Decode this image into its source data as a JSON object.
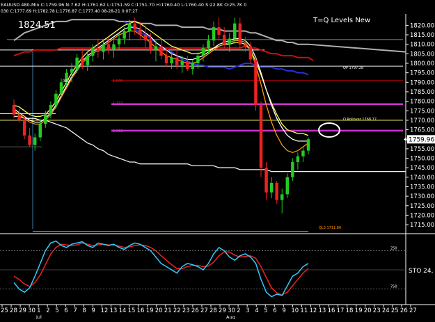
{
  "header": {
    "symbol_line": "EAUUSD 480-Min  C:1759.96 N:7.62 H:1761.62 L:1751.59 C:1751.70 H:1760.40 L:1760.40 S:22.8K O:25.7K  0",
    "sub_line": "030  C:1777.69  H:1782.78  L:1776.87  C:1777.40  08-28-21  0:07:27"
  },
  "big_price_label": "1824.51",
  "chart_title": "T=Q Levels New",
  "colors": {
    "background": "#000000",
    "up_candle": "#22cc22",
    "down_candle": "#ee2222",
    "magenta_level": "#cc33cc",
    "orange_level": "#ff9900",
    "yellow_level": "#ffff66",
    "dark_red_level": "#aa0000",
    "white_ma": "#f0f0f0",
    "gray_ma": "#b0b0b0",
    "red_ma": "#cc1111",
    "blue_ma": "#2233dd",
    "cyan_sto": "#33ccff",
    "red_sto": "#ee2222"
  },
  "chart_data": {
    "type": "candlestick",
    "title": "T=Q Levels New",
    "timeframe": "480-Min",
    "ylim": [
      1711,
      1826
    ],
    "yticks": [
      1715,
      1720,
      1725,
      1730,
      1735,
      1740,
      1745,
      1750,
      1755,
      1760,
      1765,
      1770,
      1775,
      1780,
      1785,
      1790,
      1795,
      1800,
      1805,
      1810,
      1815,
      1820
    ],
    "x_day_labels": [
      "25",
      "28",
      "29",
      "30",
      "1",
      "2",
      "5",
      "6",
      "7",
      "8",
      "9",
      "12",
      "13",
      "14",
      "15",
      "16",
      "19",
      "20",
      "21",
      "22",
      "23",
      "26",
      "27",
      "28",
      "29",
      "30",
      "2",
      "3",
      "4",
      "5",
      "6",
      "9",
      "10",
      "11",
      "12",
      "13",
      "16",
      "17",
      "18",
      "19",
      "20",
      "23",
      "24",
      "25",
      "26",
      "27"
    ],
    "x_month_labels": [
      "Jul",
      "Aug"
    ],
    "last_price": "1759.96",
    "levels": [
      {
        "name": "1.000",
        "value": 1791.0,
        "color": "#aa0000"
      },
      {
        "name": "1.272",
        "value": 1778.5,
        "color": "#cc33cc"
      },
      {
        "name": "1.618",
        "value": 1764.5,
        "color": "#cc33cc"
      },
      {
        "name": "yellow-level",
        "value": 1770.0,
        "color": "#ffff66"
      },
      {
        "name": "white-level",
        "value": 1798.5,
        "color": "#f0f0f0"
      },
      {
        "name": "orange-bottom",
        "value": 1711.5,
        "color": "#ff9900"
      }
    ],
    "level_labels": {
      "l1000": "1.000",
      "l1272": "1.272",
      "l1618": "1.618",
      "qp": "QP 1797.28",
      "rollover": "Q Rollover 1768.77",
      "ql3": "QL3 1711.80",
      "n1": "080"
    },
    "candles": [
      [
        1778,
        1781,
        1771,
        1773
      ],
      [
        1773,
        1776,
        1769,
        1770
      ],
      [
        1770,
        1772,
        1760,
        1762
      ],
      [
        1762,
        1766,
        1756,
        1757
      ],
      [
        1757,
        1763,
        1754,
        1761
      ],
      [
        1761,
        1770,
        1759,
        1768
      ],
      [
        1768,
        1775,
        1766,
        1773
      ],
      [
        1773,
        1780,
        1771,
        1778
      ],
      [
        1778,
        1786,
        1776,
        1784
      ],
      [
        1784,
        1792,
        1782,
        1790
      ],
      [
        1790,
        1797,
        1788,
        1795
      ],
      [
        1795,
        1800,
        1790,
        1797
      ],
      [
        1797,
        1805,
        1795,
        1803
      ],
      [
        1803,
        1808,
        1797,
        1799
      ],
      [
        1799,
        1806,
        1796,
        1804
      ],
      [
        1804,
        1810,
        1801,
        1808
      ],
      [
        1808,
        1813,
        1803,
        1806
      ],
      [
        1806,
        1812,
        1802,
        1810
      ],
      [
        1810,
        1814,
        1805,
        1807
      ],
      [
        1807,
        1812,
        1803,
        1810
      ],
      [
        1810,
        1816,
        1807,
        1813
      ],
      [
        1813,
        1819,
        1810,
        1817
      ],
      [
        1817,
        1823,
        1812,
        1821
      ],
      [
        1821,
        1824,
        1815,
        1818
      ],
      [
        1818,
        1822,
        1812,
        1815
      ],
      [
        1815,
        1820,
        1808,
        1812
      ],
      [
        1812,
        1816,
        1805,
        1807
      ],
      [
        1807,
        1812,
        1801,
        1809
      ],
      [
        1809,
        1813,
        1802,
        1804
      ],
      [
        1804,
        1808,
        1798,
        1800
      ],
      [
        1800,
        1806,
        1797,
        1803
      ],
      [
        1803,
        1807,
        1797,
        1799
      ],
      [
        1799,
        1804,
        1795,
        1801
      ],
      [
        1801,
        1804,
        1796,
        1797
      ],
      [
        1797,
        1802,
        1794,
        1800
      ],
      [
        1800,
        1806,
        1797,
        1804
      ],
      [
        1804,
        1810,
        1801,
        1808
      ],
      [
        1808,
        1815,
        1805,
        1812
      ],
      [
        1812,
        1822,
        1809,
        1819
      ],
      [
        1819,
        1824,
        1812,
        1815
      ],
      [
        1815,
        1819,
        1808,
        1810
      ],
      [
        1810,
        1816,
        1806,
        1813
      ],
      [
        1813,
        1824,
        1810,
        1821
      ],
      [
        1821,
        1824,
        1808,
        1810
      ],
      [
        1810,
        1814,
        1806,
        1809
      ],
      [
        1809,
        1811,
        1800,
        1802
      ],
      [
        1802,
        1803,
        1775,
        1778
      ],
      [
        1778,
        1780,
        1740,
        1745
      ],
      [
        1745,
        1748,
        1728,
        1732
      ],
      [
        1732,
        1740,
        1729,
        1737
      ],
      [
        1737,
        1738,
        1726,
        1728
      ],
      [
        1728,
        1734,
        1721,
        1731
      ],
      [
        1731,
        1742,
        1729,
        1740
      ],
      [
        1740,
        1750,
        1738,
        1748
      ],
      [
        1748,
        1753,
        1744,
        1751
      ],
      [
        1751,
        1756,
        1748,
        1754
      ],
      [
        1754,
        1761,
        1752,
        1760
      ]
    ],
    "stochastic": {
      "label": "STO 24,",
      "levels": [
        80,
        20
      ],
      "level_labels": [
        "250",
        "750"
      ],
      "k": [
        30,
        20,
        15,
        22,
        40,
        60,
        80,
        92,
        95,
        88,
        85,
        90,
        92,
        94,
        88,
        85,
        92,
        90,
        88,
        90,
        85,
        82,
        88,
        92,
        90,
        85,
        80,
        70,
        60,
        55,
        50,
        45,
        55,
        60,
        58,
        55,
        50,
        60,
        75,
        85,
        80,
        70,
        65,
        72,
        75,
        70,
        60,
        35,
        15,
        8,
        12,
        10,
        25,
        40,
        45,
        55,
        60
      ],
      "d": [
        40,
        35,
        28,
        24,
        30,
        42,
        58,
        75,
        85,
        90,
        89,
        88,
        89,
        92,
        90,
        88,
        89,
        90,
        89,
        89,
        87,
        85,
        86,
        88,
        89,
        88,
        85,
        80,
        72,
        65,
        58,
        52,
        52,
        55,
        57,
        57,
        55,
        56,
        62,
        72,
        78,
        78,
        73,
        70,
        71,
        72,
        68,
        55,
        38,
        22,
        14,
        11,
        15,
        25,
        35,
        45,
        52
      ]
    },
    "overlay_lines": [
      {
        "name": "white-ma-long",
        "color": "#f0f0f0",
        "values": [
          1772,
          1772,
          1771,
          1771,
          1771,
          1770,
          1770,
          1769,
          1768,
          1767,
          1766,
          1764,
          1762,
          1760,
          1758,
          1757,
          1755,
          1754,
          1752,
          1751,
          1750,
          1749,
          1748,
          1748,
          1747,
          1747,
          1747,
          1747,
          1747,
          1747,
          1747,
          1747,
          1747,
          1747,
          1746,
          1746,
          1746,
          1746,
          1746,
          1745,
          1745,
          1745,
          1745,
          1744,
          1744,
          1744,
          1744,
          1744,
          1744,
          1743,
          1743,
          1743,
          1743,
          1743,
          1743,
          1743,
          1743
        ]
      },
      {
        "name": "gray-ma",
        "color": "#b0b0b0",
        "values": [
          1812,
          1814,
          1816,
          1817,
          1818,
          1819,
          1820,
          1821,
          1822,
          1822,
          1822,
          1823,
          1823,
          1823,
          1823,
          1823,
          1823,
          1823,
          1823,
          1823,
          1822,
          1822,
          1822,
          1822,
          1821,
          1821,
          1821,
          1820,
          1820,
          1820,
          1820,
          1820,
          1819,
          1819,
          1819,
          1819,
          1819,
          1818,
          1818,
          1818,
          1817,
          1817,
          1817,
          1817,
          1817,
          1816,
          1816,
          1815,
          1814,
          1813,
          1812,
          1812,
          1811,
          1811,
          1810,
          1810,
          1810
        ]
      },
      {
        "name": "red-ma",
        "color": "#cc1111",
        "values": [
          1804,
          1805,
          1806,
          1806,
          1807,
          1807,
          1807,
          1807,
          1807,
          1808,
          1808,
          1808,
          1808,
          1808,
          1808,
          1808,
          1808,
          1808,
          1808,
          1808,
          1808,
          1808,
          1808,
          1808,
          1808,
          1808,
          1808,
          1808,
          1808,
          1808,
          1808,
          1808,
          1808,
          1808,
          1808,
          1808,
          1808,
          1808,
          1808,
          1808,
          1808,
          1808,
          1808,
          1808,
          1809,
          1808,
          1808,
          1807,
          1806,
          1805,
          1805,
          1804,
          1804,
          1804,
          1803,
          1803,
          1803
        ]
      },
      {
        "name": "blue-ma",
        "color": "#2233dd",
        "values": [
          null,
          null,
          null,
          null,
          null,
          null,
          null,
          null,
          null,
          null,
          null,
          null,
          null,
          null,
          null,
          null,
          null,
          null,
          null,
          null,
          null,
          1822,
          1820,
          1818,
          1816,
          1815,
          1813,
          1811,
          1809,
          1807,
          1806,
          1804,
          1802,
          1801,
          1800,
          1799,
          1799,
          1798,
          1798,
          1798,
          1798,
          1797,
          1798,
          1799,
          1800,
          1800,
          1799,
          1798,
          1798,
          1798,
          1797,
          1797,
          1796,
          1796,
          1795,
          1795,
          1794
        ]
      },
      {
        "name": "yellow-ma",
        "color": "#ffff66",
        "values": [
          1778,
          1777,
          1775,
          1773,
          1772,
          1772,
          1773,
          1776,
          1780,
          1785,
          1790,
          1795,
          1799,
          1803,
          1806,
          1808,
          1810,
          1812,
          1814,
          1816,
          1818,
          1820,
          1821,
          1822,
          1821,
          1819,
          1817,
          1815,
          1813,
          1811,
          1809,
          1808,
          1807,
          1806,
          1805,
          1805,
          1806,
          1807,
          1808,
          1809,
          1810,
          1810,
          1811,
          1811,
          1810,
          1807,
          1801,
          1794,
          1786,
          1779,
          1773,
          1768,
          1765,
          1764,
          1763,
          1763,
          1762
        ]
      },
      {
        "name": "orange-ma",
        "color": "#ff9900",
        "values": [
          1775,
          1773,
          1771,
          1769,
          1768,
          1768,
          1770,
          1773,
          1777,
          1782,
          1787,
          1792,
          1796,
          1800,
          1803,
          1805,
          1807,
          1809,
          1811,
          1813,
          1815,
          1816,
          1817,
          1817,
          1815,
          1813,
          1811,
          1808,
          1806,
          1804,
          1803,
          1802,
          1801,
          1800,
          1800,
          1801,
          1803,
          1805,
          1807,
          1809,
          1810,
          1811,
          1812,
          1812,
          1811,
          1807,
          1799,
          1789,
          1778,
          1769,
          1762,
          1757,
          1754,
          1753,
          1754,
          1756,
          1758
        ]
      },
      {
        "name": "white-ma-short",
        "color": "#ffffff",
        "values": [
          1776,
          1774,
          1772,
          1770,
          1769,
          1769,
          1771,
          1774,
          1778,
          1783,
          1788,
          1793,
          1797,
          1801,
          1804,
          1806,
          1808,
          1810,
          1812,
          1814,
          1816,
          1818,
          1819,
          1819,
          1818,
          1816,
          1814,
          1811,
          1809,
          1807,
          1805,
          1804,
          1803,
          1802,
          1802,
          1803,
          1804,
          1806,
          1808,
          1810,
          1811,
          1812,
          1813,
          1813,
          1812,
          1809,
          1803,
          1795,
          1786,
          1778,
          1771,
          1766,
          1762,
          1760,
          1759,
          1759,
          1759
        ]
      }
    ]
  }
}
